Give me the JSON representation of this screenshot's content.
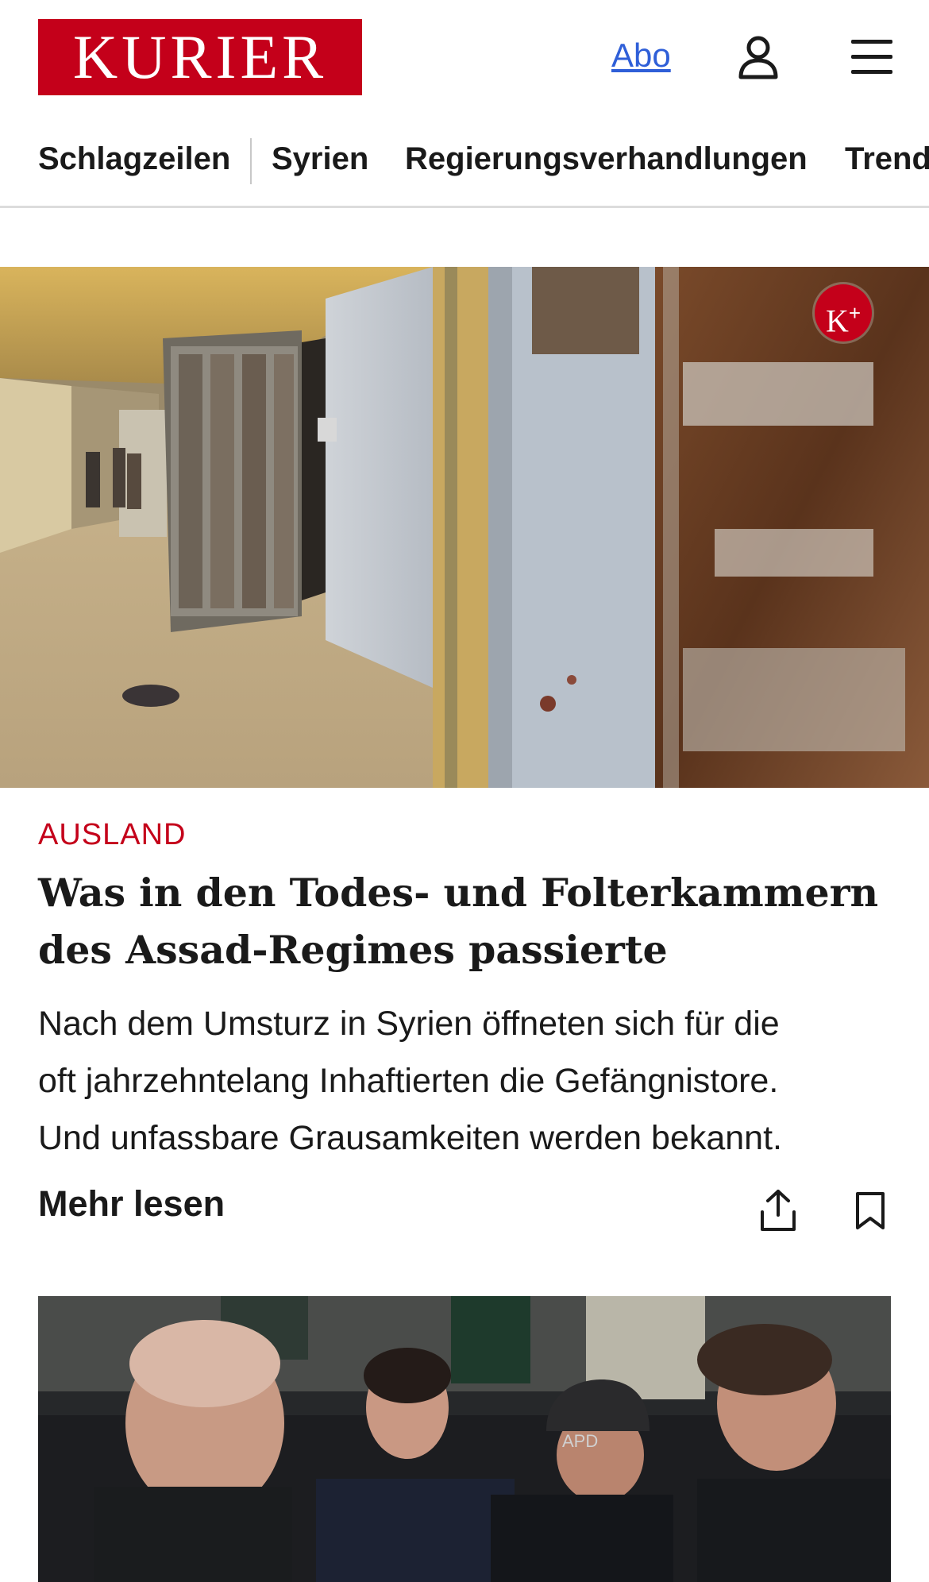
{
  "header": {
    "logo": "KURIER",
    "abo_label": "Abo",
    "user_icon": "user-icon",
    "menu_icon": "hamburger-menu-icon"
  },
  "nav": {
    "items": [
      {
        "label": "Schlagzeilen"
      },
      {
        "label": "Syrien"
      },
      {
        "label": "Regierungsverhandlungen"
      },
      {
        "label": "Trend"
      }
    ]
  },
  "article": {
    "badge": "K+",
    "category": "AUSLAND",
    "headline_line1": "Was in den Todes- und Folterkammern",
    "headline_line2": "des Assad-Regimes passierte",
    "teaser_line1": "Nach dem Umsturz in Syrien öffneten sich für die",
    "teaser_line2": "oft jahrzehntelang Inhaftierten die Gefängnistore.",
    "teaser_line3": "Und unfassbare Grausamkeiten werden bekannt.",
    "more_label": "Mehr lesen",
    "share_icon": "share-icon",
    "bookmark_icon": "bookmark-icon"
  },
  "next_article": {
    "image_text": "APD"
  },
  "colors": {
    "brand_red": "#c4001a",
    "link_blue": "#2f5fd8",
    "text": "#1a1a1a"
  }
}
